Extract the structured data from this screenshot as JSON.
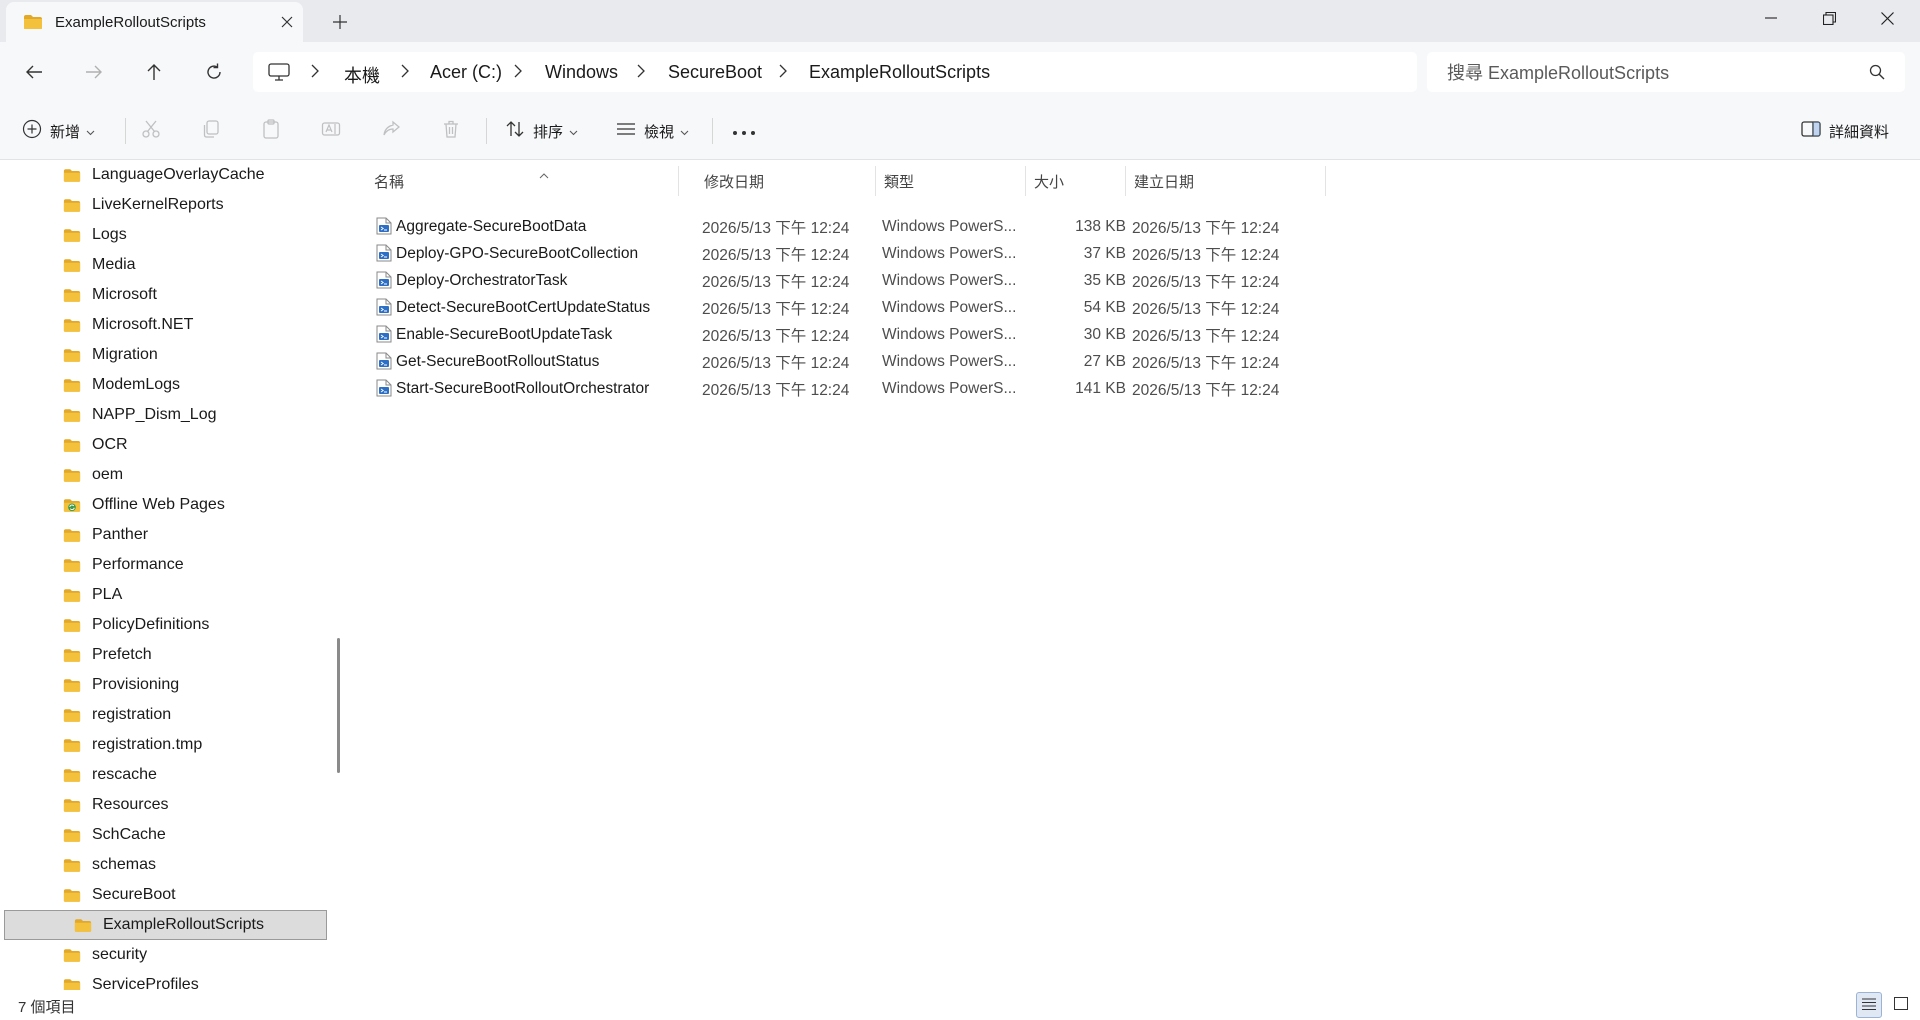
{
  "tab": {
    "title": "ExampleRolloutScripts"
  },
  "breadcrumb": [
    "本機",
    "Acer (C:)",
    "Windows",
    "SecureBoot",
    "ExampleRolloutScripts"
  ],
  "search": {
    "placeholder": "搜尋 ExampleRolloutScripts"
  },
  "toolbar": {
    "new_label": "新增",
    "sort_label": "排序",
    "view_label": "檢視",
    "details_label": "詳細資料"
  },
  "sidebar": {
    "items": [
      {
        "label": "LanguageOverlayCache",
        "icon": "folder-icon"
      },
      {
        "label": "LiveKernelReports",
        "icon": "folder-icon"
      },
      {
        "label": "Logs",
        "icon": "folder-icon"
      },
      {
        "label": "Media",
        "icon": "folder-icon"
      },
      {
        "label": "Microsoft",
        "icon": "folder-icon"
      },
      {
        "label": "Microsoft.NET",
        "icon": "folder-icon"
      },
      {
        "label": "Migration",
        "icon": "folder-icon"
      },
      {
        "label": "ModemLogs",
        "icon": "folder-icon"
      },
      {
        "label": "NAPP_Dism_Log",
        "icon": "folder-icon"
      },
      {
        "label": "OCR",
        "icon": "folder-icon"
      },
      {
        "label": "oem",
        "icon": "folder-icon"
      },
      {
        "label": "Offline Web Pages",
        "icon": "offline-pages-icon"
      },
      {
        "label": "Panther",
        "icon": "folder-icon"
      },
      {
        "label": "Performance",
        "icon": "folder-icon"
      },
      {
        "label": "PLA",
        "icon": "folder-icon"
      },
      {
        "label": "PolicyDefinitions",
        "icon": "folder-icon"
      },
      {
        "label": "Prefetch",
        "icon": "folder-icon"
      },
      {
        "label": "Provisioning",
        "icon": "folder-icon"
      },
      {
        "label": "registration",
        "icon": "folder-icon"
      },
      {
        "label": "registration.tmp",
        "icon": "folder-icon"
      },
      {
        "label": "rescache",
        "icon": "folder-icon"
      },
      {
        "label": "Resources",
        "icon": "folder-icon"
      },
      {
        "label": "SchCache",
        "icon": "folder-icon"
      },
      {
        "label": "schemas",
        "icon": "folder-icon"
      },
      {
        "label": "SecureBoot",
        "icon": "folder-icon"
      },
      {
        "label": "ExampleRolloutScripts",
        "icon": "folder-icon",
        "child": true,
        "selected": true
      },
      {
        "label": "security",
        "icon": "folder-icon"
      },
      {
        "label": "ServiceProfiles",
        "icon": "folder-icon"
      }
    ]
  },
  "columns": [
    "名稱",
    "修改日期",
    "類型",
    "大小",
    "建立日期"
  ],
  "files": [
    {
      "name": "Aggregate-SecureBootData",
      "modified": "2026/5/13 下午 12:24",
      "type": "Windows PowerS...",
      "size": "138 KB",
      "created": "2026/5/13 下午 12:24"
    },
    {
      "name": "Deploy-GPO-SecureBootCollection",
      "modified": "2026/5/13 下午 12:24",
      "type": "Windows PowerS...",
      "size": "37 KB",
      "created": "2026/5/13 下午 12:24"
    },
    {
      "name": "Deploy-OrchestratorTask",
      "modified": "2026/5/13 下午 12:24",
      "type": "Windows PowerS...",
      "size": "35 KB",
      "created": "2026/5/13 下午 12:24"
    },
    {
      "name": "Detect-SecureBootCertUpdateStatus",
      "modified": "2026/5/13 下午 12:24",
      "type": "Windows PowerS...",
      "size": "54 KB",
      "created": "2026/5/13 下午 12:24"
    },
    {
      "name": "Enable-SecureBootUpdateTask",
      "modified": "2026/5/13 下午 12:24",
      "type": "Windows PowerS...",
      "size": "30 KB",
      "created": "2026/5/13 下午 12:24"
    },
    {
      "name": "Get-SecureBootRolloutStatus",
      "modified": "2026/5/13 下午 12:24",
      "type": "Windows PowerS...",
      "size": "27 KB",
      "created": "2026/5/13 下午 12:24"
    },
    {
      "name": "Start-SecureBootRolloutOrchestrator",
      "modified": "2026/5/13 下午 12:24",
      "type": "Windows PowerS...",
      "size": "141 KB",
      "created": "2026/5/13 下午 12:24"
    }
  ],
  "status": {
    "item_count": "7 個項目"
  },
  "colors": {
    "folder": "#f4c13d",
    "folder_dark": "#e1a82a",
    "selected_bg": "#dcdcdc"
  }
}
